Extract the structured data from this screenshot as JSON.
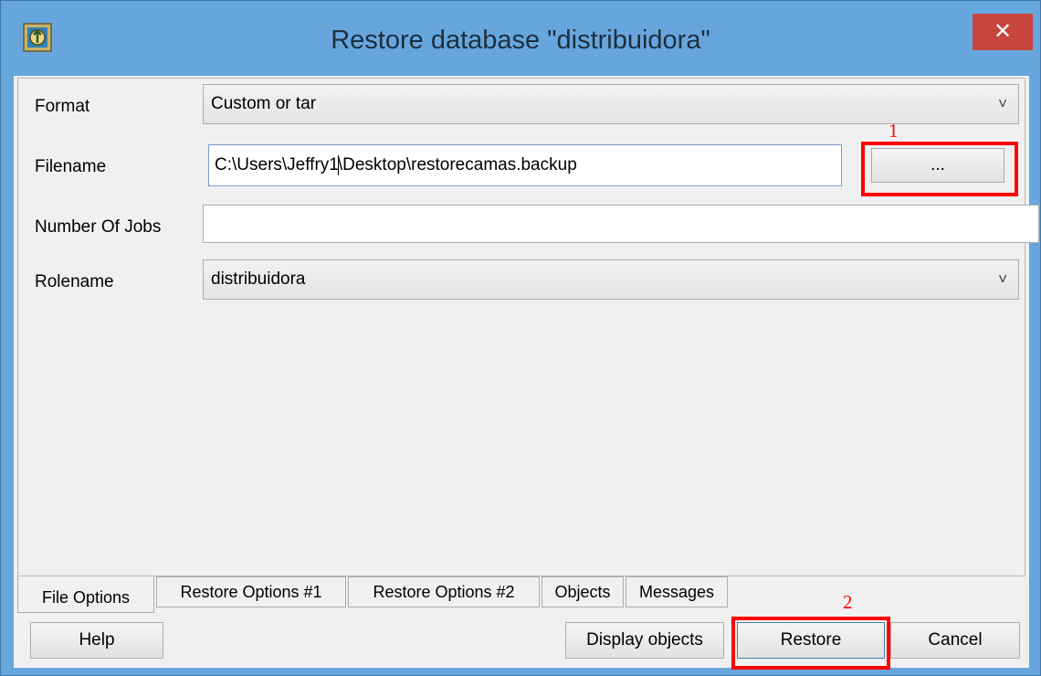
{
  "window": {
    "title": "Restore database \"distribuidora\"",
    "close_glyph": "✕"
  },
  "form": {
    "format_label": "Format",
    "format_value": "Custom or tar",
    "filename_label": "Filename",
    "filename_before_caret": "C:\\Users\\Jeffry1",
    "filename_after_caret": "\\Desktop\\restorecamas.backup",
    "jobs_label": "Number Of Jobs",
    "jobs_value": "",
    "rolename_label": "Rolename",
    "rolename_value": "distribuidora",
    "browse_label": "..."
  },
  "dropdown_glyph": "˅",
  "annotations": {
    "first": "1",
    "second": "2"
  },
  "tabs": [
    {
      "label": "File Options",
      "active": true
    },
    {
      "label": "Restore Options #1",
      "active": false
    },
    {
      "label": "Restore Options #2",
      "active": false
    },
    {
      "label": "Objects",
      "active": false
    },
    {
      "label": "Messages",
      "active": false
    }
  ],
  "buttons": {
    "help": "Help",
    "display_objects": "Display objects",
    "restore": "Restore",
    "cancel": "Cancel"
  },
  "colors": {
    "titlebar": "#67a6dd",
    "close": "#c7453c",
    "highlight": "#ff0000"
  }
}
